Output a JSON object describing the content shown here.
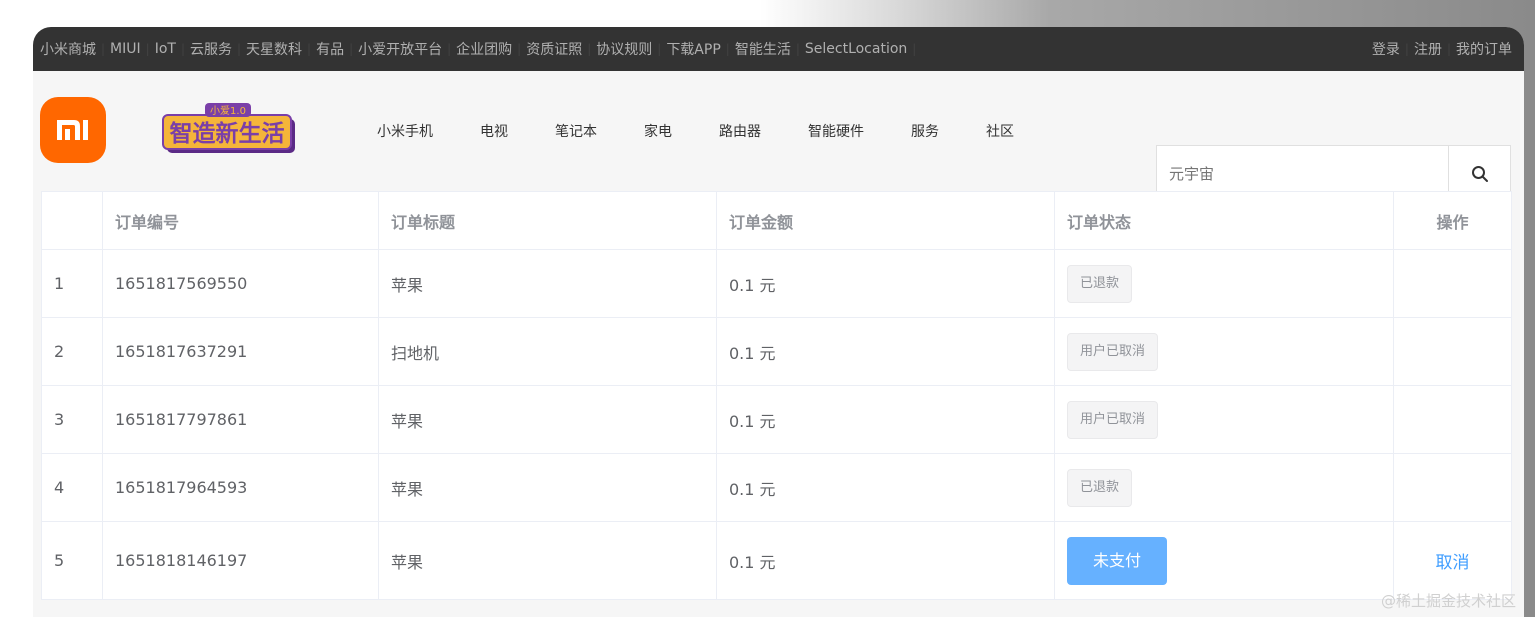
{
  "topbar": {
    "links": [
      "小米商城",
      "MIUI",
      "IoT",
      "云服务",
      "天星数科",
      "有品",
      "小爱开放平台",
      "企业团购",
      "资质证照",
      "协议规则",
      "下载APP",
      "智能生活",
      "SelectLocation"
    ],
    "login": "登录",
    "register": "注册",
    "my_orders": "我的订单"
  },
  "header": {
    "logo_text": "mi",
    "nav": [
      "小米手机",
      "电视",
      "笔记本",
      "家电",
      "路由器",
      "智能硬件",
      "服务",
      "社区"
    ],
    "search_placeholder": "元宇宙",
    "banner_subtitle": "小爱1.0",
    "banner_title": "智造新生活"
  },
  "table": {
    "headers": [
      "",
      "订单编号",
      "订单标题",
      "订单金额",
      "订单状态",
      "操作"
    ],
    "rows": [
      {
        "index": "1",
        "id": "1651817569550",
        "title": "苹果",
        "amount": "0.1 元",
        "status": "已退款",
        "action": ""
      },
      {
        "index": "2",
        "id": "1651817637291",
        "title": "扫地机",
        "amount": "0.1 元",
        "status": "用户已取消",
        "action": ""
      },
      {
        "index": "3",
        "id": "1651817797861",
        "title": "苹果",
        "amount": "0.1 元",
        "status": "用户已取消",
        "action": ""
      },
      {
        "index": "4",
        "id": "1651817964593",
        "title": "苹果",
        "amount": "0.1 元",
        "status": "已退款",
        "action": ""
      },
      {
        "index": "5",
        "id": "1651818146197",
        "title": "苹果",
        "amount": "0.1 元",
        "status": "未支付",
        "action": "取消"
      }
    ]
  },
  "watermark": "@稀土掘金技术社区",
  "colors": {
    "brand": "#ff6700",
    "topbar": "#333333",
    "pay_button": "#66b1ff",
    "link": "#409eff"
  }
}
